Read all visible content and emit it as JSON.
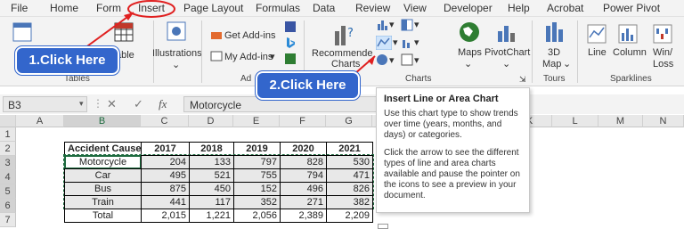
{
  "menu": {
    "items": [
      "File",
      "Home",
      "Form",
      "Insert",
      "Page Layout",
      "Formulas",
      "Data",
      "Review",
      "View",
      "Developer",
      "Help",
      "Acrobat",
      "Power Pivot"
    ]
  },
  "ribbon": {
    "tables_partial": "able",
    "illustrations": "Illustrations",
    "get_addins": "Get Add-ins",
    "my_addins": "My Add-ins",
    "addins_partial": "Ad",
    "recommended_charts": "Recommended Charts",
    "recommended_partial_1": "Recommende",
    "recommended_partial_2": "Charts",
    "maps": "Maps",
    "pivotchart": "PivotChart",
    "map3d_1": "3D",
    "map3d_2": "Map",
    "line": "Line",
    "column": "Column",
    "winloss_1": "Win/",
    "winloss_2": "Loss",
    "groups": {
      "tables": "Tables",
      "charts": "Charts",
      "tours": "Tours",
      "sparklines": "Sparklines"
    }
  },
  "formula_bar": {
    "name_box": "B3",
    "cancel": "✕",
    "enter": "✓",
    "fx": "fx",
    "value": "Motorcycle"
  },
  "columns": [
    "A",
    "B",
    "C",
    "D",
    "E",
    "F",
    "G",
    "H",
    "I",
    "J",
    "K",
    "L",
    "M",
    "N"
  ],
  "rows": [
    "1",
    "2",
    "3",
    "4",
    "5",
    "6",
    "7"
  ],
  "table": {
    "header": [
      "Accident Cause",
      "2017",
      "2018",
      "2019",
      "2020",
      "2021"
    ],
    "data": [
      [
        "Motorcycle",
        "204",
        "133",
        "797",
        "828",
        "530"
      ],
      [
        "Car",
        "495",
        "521",
        "755",
        "794",
        "471"
      ],
      [
        "Bus",
        "875",
        "450",
        "152",
        "496",
        "826"
      ],
      [
        "Train",
        "441",
        "117",
        "352",
        "271",
        "382"
      ]
    ],
    "total": [
      "Total",
      "2,015",
      "1,221",
      "2,056",
      "2,389",
      "2,209"
    ]
  },
  "tooltip": {
    "title": "Insert Line or Area Chart",
    "p1": "Use this chart type to show trends over time (years, months, and days) or categories.",
    "p2": "Click the arrow to see the different types of line and area charts available and pause the pointer on the icons to see a preview in your document."
  },
  "callouts": {
    "step1": "1.Click Here",
    "step2": "2.Click Here"
  },
  "colors": {
    "callout_blue": "#3366cc",
    "annotation_red": "#e02020",
    "excel_green": "#1e6b3f"
  }
}
